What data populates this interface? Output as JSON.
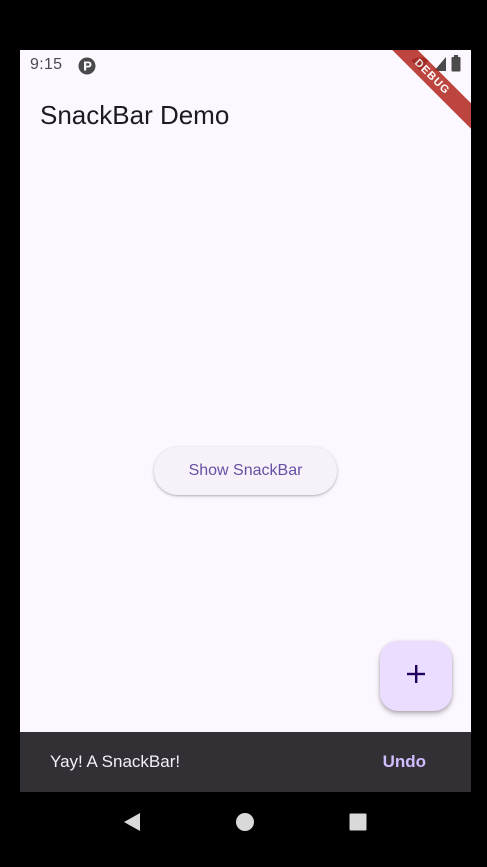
{
  "status_bar": {
    "time": "9:15",
    "debug_label": "DEBUG"
  },
  "app_bar": {
    "title": "SnackBar Demo"
  },
  "main": {
    "button_label": "Show SnackBar"
  },
  "fab": {
    "icon": "plus-icon"
  },
  "snackbar": {
    "message": "Yay! A SnackBar!",
    "action_label": "Undo"
  },
  "nav_bar": {
    "buttons": [
      "back-icon",
      "home-icon",
      "recents-icon"
    ]
  },
  "colors": {
    "background": "#fdf7ff",
    "primary": "#6750a4",
    "fab_container": "#eaddff",
    "snackbar_bg": "#322f35",
    "snackbar_action": "#d0bcff",
    "debug_banner": "#b3261e"
  }
}
